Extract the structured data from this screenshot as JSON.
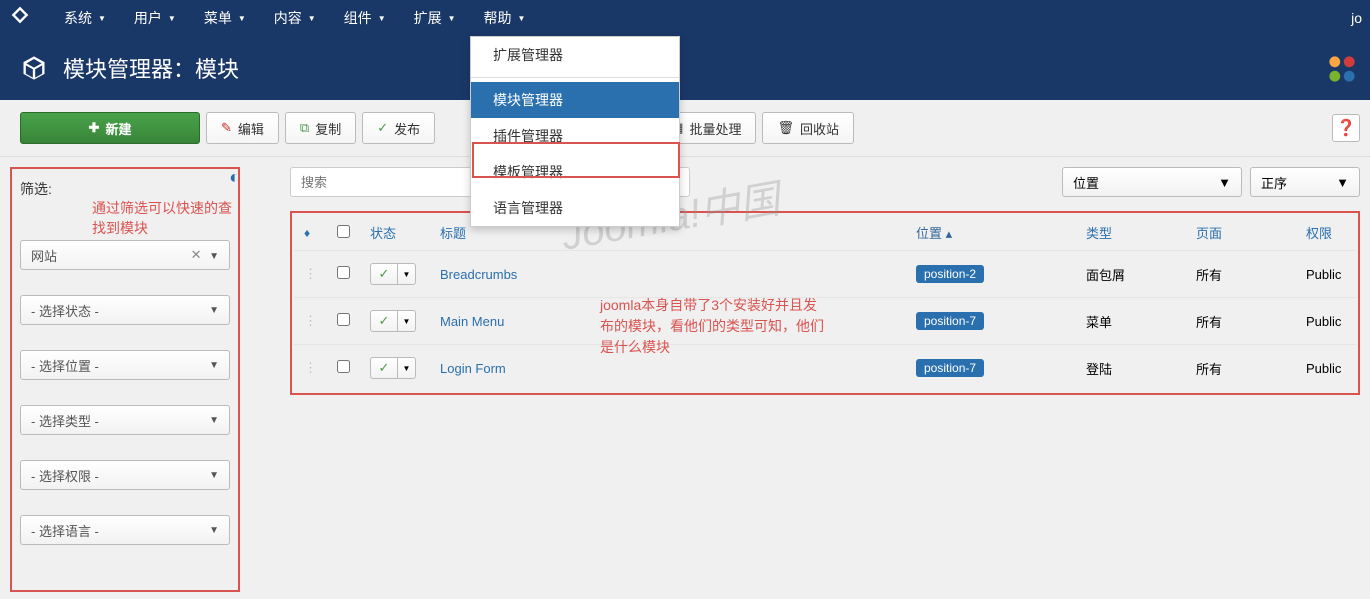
{
  "top_menu": {
    "items": [
      "系统",
      "用户",
      "菜单",
      "内容",
      "组件",
      "扩展",
      "帮助"
    ],
    "right": "jo"
  },
  "dropdown": {
    "items": [
      "扩展管理器",
      "模块管理器",
      "插件管理器",
      "模板管理器",
      "语言管理器"
    ],
    "active_index": 1
  },
  "title": "模块管理器：模块",
  "toolbar": {
    "new": "新建",
    "edit": "编辑",
    "copy": "复制",
    "publish": "发布",
    "batch": "批量处理",
    "recycle": "回收站"
  },
  "sidebar": {
    "filter_label": "筛选:",
    "annot": "通过筛选可以快速的查找到模块",
    "site": "网站",
    "selects": [
      "- 选择状态 -",
      "- 选择位置 -",
      "- 选择类型 -",
      "- 选择权限 -",
      "- 选择语言 -"
    ]
  },
  "search": {
    "placeholder": "搜索",
    "sort1": "位置",
    "sort2": "正序"
  },
  "table": {
    "headers": {
      "status": "状态",
      "title": "标题",
      "position": "位置",
      "type": "类型",
      "page": "页面",
      "access": "权限"
    },
    "rows": [
      {
        "title": "Breadcrumbs",
        "position": "position-2",
        "type": "面包屑",
        "page": "所有",
        "access": "Public"
      },
      {
        "title": "Main Menu",
        "position": "position-7",
        "type": "菜单",
        "page": "所有",
        "access": "Public"
      },
      {
        "title": "Login Form",
        "position": "position-7",
        "type": "登陆",
        "page": "所有",
        "access": "Public"
      }
    ],
    "annot": "joomla本身自带了3个安装好并且发布的模块，看他们的类型可知，他们是什么模块"
  },
  "watermark": "Joomla!中国"
}
